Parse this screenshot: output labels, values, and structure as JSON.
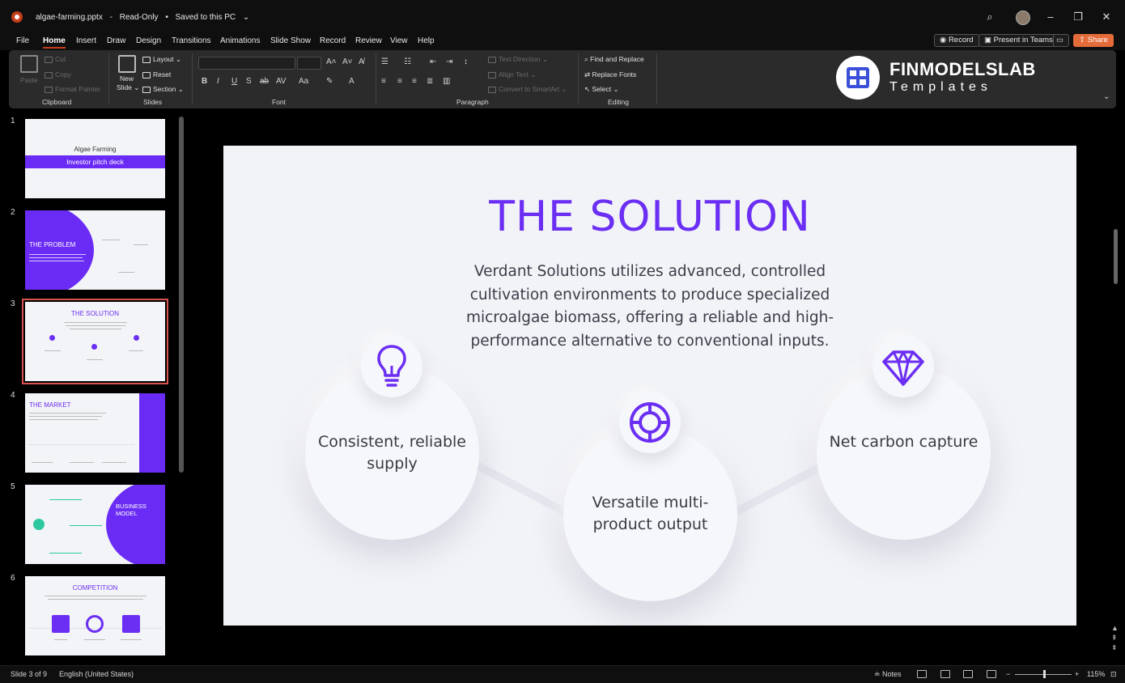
{
  "window": {
    "filename": "algae-farming.pptx",
    "mode": "Read-Only",
    "save_status": "Saved to this PC"
  },
  "menu": {
    "tabs": [
      "File",
      "Home",
      "Insert",
      "Draw",
      "Design",
      "Transitions",
      "Animations",
      "Slide Show",
      "Record",
      "Review",
      "View",
      "Help"
    ],
    "active": "Home",
    "record_label": "Record",
    "teams_label": "Present in Teams",
    "share_label": "Share"
  },
  "ribbon": {
    "clipboard": {
      "paste": "Paste",
      "cut": "Cut",
      "copy": "Copy",
      "format_painter": "Format Painter",
      "label": "Clipboard"
    },
    "slides": {
      "new_slide": "New",
      "new_slide2": "Slide",
      "layout": "Layout",
      "reset": "Reset",
      "section": "Section",
      "label": "Slides"
    },
    "font": {
      "label": "Font"
    },
    "paragraph": {
      "text_direction": "Text Direction",
      "align_text": "Align Text",
      "convert_smartart": "Convert to SmartArt",
      "label": "Paragraph"
    },
    "editing": {
      "find_replace": "Find and Replace",
      "replace_fonts": "Replace Fonts",
      "select": "Select",
      "label": "Editing"
    }
  },
  "brand": {
    "name": "FINMODELSLAB",
    "sub": "Templates"
  },
  "thumbnails": [
    {
      "num": "1",
      "title": "Algae Farming",
      "subtitle": "Investor pitch deck"
    },
    {
      "num": "2",
      "title": "THE PROBLEM"
    },
    {
      "num": "3",
      "title": "THE SOLUTION"
    },
    {
      "num": "4",
      "title": "THE MARKET"
    },
    {
      "num": "5",
      "title": "BUSINESS MODEL"
    },
    {
      "num": "6",
      "title": "COMPETITION"
    }
  ],
  "slide": {
    "title": "THE SOLUTION",
    "body": "Verdant Solutions utilizes advanced, controlled cultivation environments to produce specialized microalgae biomass, offering a reliable and high-performance alternative to conventional inputs.",
    "features": [
      {
        "label": "Consistent, reliable supply",
        "icon": "lightbulb-icon"
      },
      {
        "label": "Versatile multi-product output",
        "icon": "target-icon"
      },
      {
        "label": "Net carbon capture",
        "icon": "diamond-icon"
      }
    ],
    "accent": "#6b2ef3"
  },
  "status": {
    "slide_info": "Slide 3 of 9",
    "language": "English (United States)",
    "notes": "Notes",
    "zoom": "115%"
  }
}
